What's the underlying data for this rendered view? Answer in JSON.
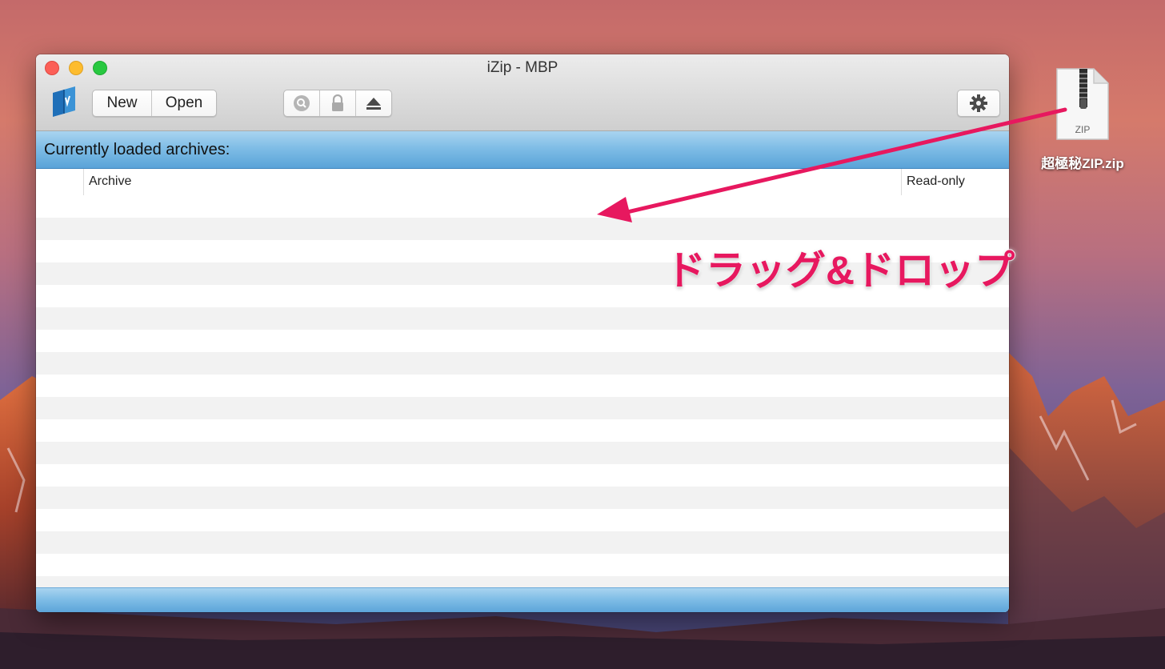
{
  "window": {
    "title": "iZip - MBP"
  },
  "toolbar": {
    "app_icon": "izip-book-icon",
    "new_label": "New",
    "open_label": "Open",
    "tools": [
      {
        "icon": "search-icon"
      },
      {
        "icon": "lock-icon"
      },
      {
        "icon": "eject-icon"
      }
    ],
    "settings_icon": "gear-icon"
  },
  "archives_panel": {
    "heading": "Currently loaded archives:",
    "columns": [
      "Archive",
      "Read-only"
    ],
    "rows": []
  },
  "desktop": {
    "file": {
      "name": "超極秘ZIP.zip",
      "badge": "ZIP",
      "icon": "zip-file-icon"
    },
    "annotation": {
      "text": "ドラッグ&ドロップ",
      "color": "#e7185f"
    }
  },
  "colors": {
    "accent_bar": "#7fbde6",
    "arrow": "#e7185f"
  }
}
